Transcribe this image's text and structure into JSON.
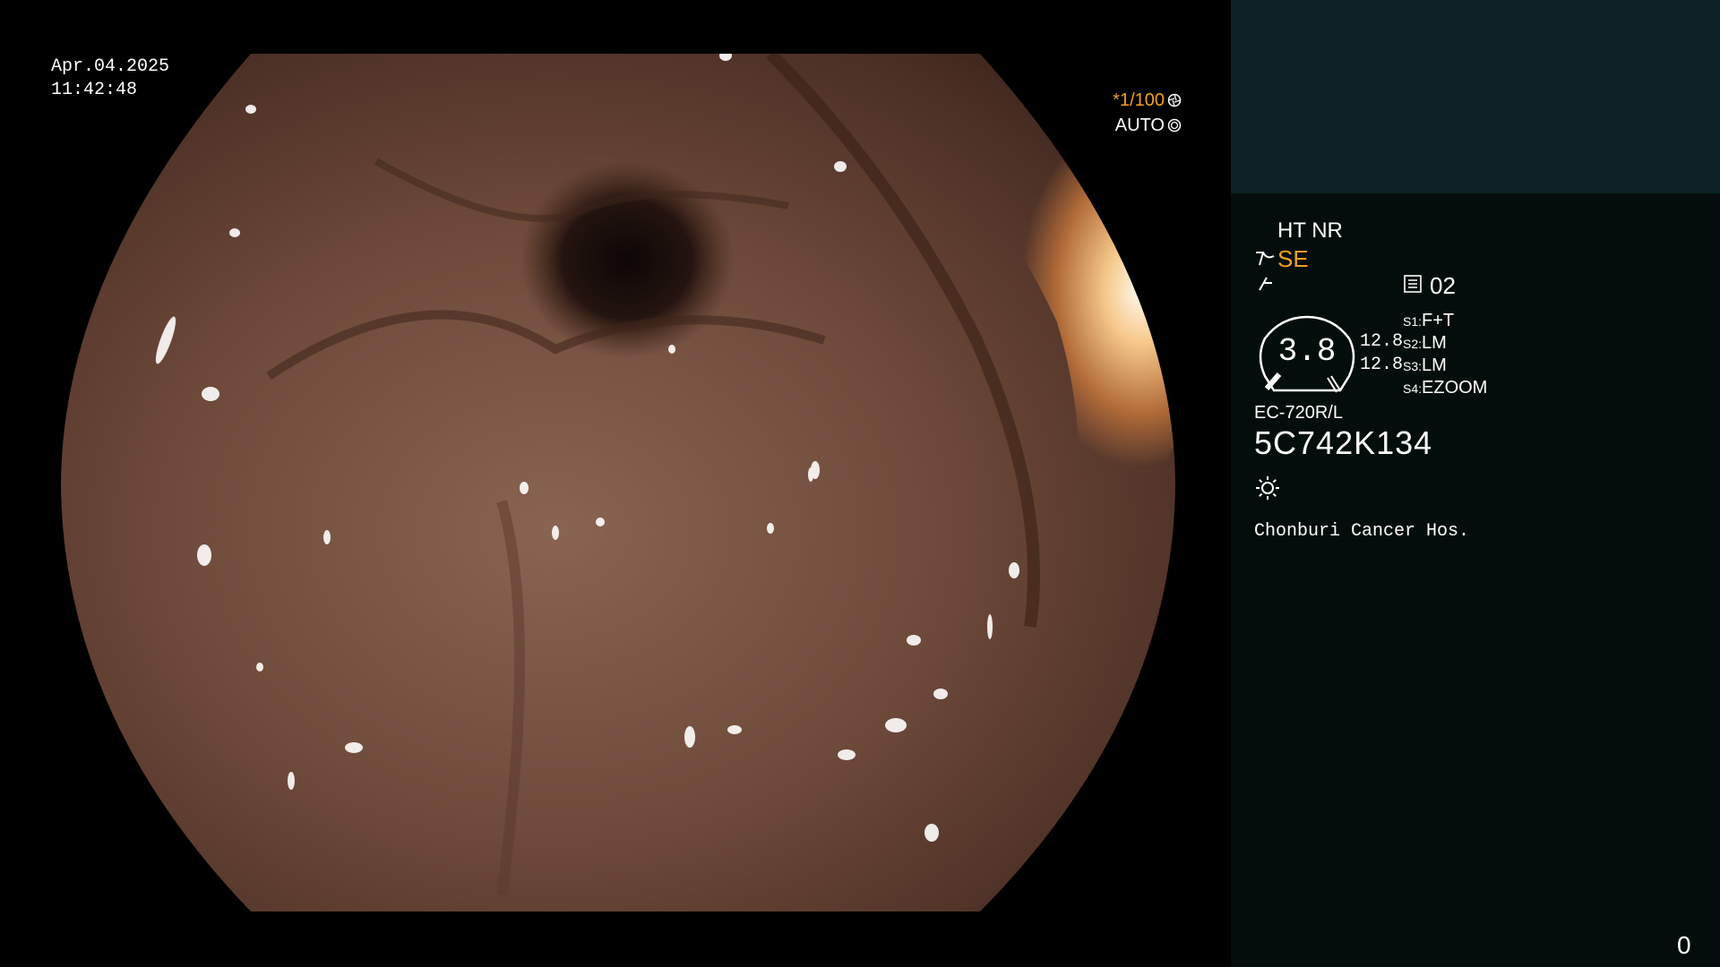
{
  "overlay": {
    "date": "Apr.04.2025",
    "time": "11:42:48",
    "shutter_speed": "*1/100",
    "exposure_mode": "AUTO",
    "icons": {
      "shutter": "shutter-icon",
      "exposure": "iris-icon"
    }
  },
  "info_panel": {
    "enhancement": "HT NR",
    "mode_label": "SE",
    "preset_number": "02",
    "dial_value": "3.8",
    "values": [
      "12.8",
      "12.8"
    ],
    "switches": [
      {
        "key": "S1:",
        "value": "F+T"
      },
      {
        "key": "S2:",
        "value": "LM"
      },
      {
        "key": "S3:",
        "value": "LM"
      },
      {
        "key": "S4:",
        "value": "EZOOM"
      }
    ],
    "scope_model": "EC-720R/L",
    "scope_serial": "5C742K134",
    "hospital": "Chonburi Cancer Hos.",
    "frame_counter": "0",
    "icons": [
      "structure-enhance-icon",
      "contrast-icon",
      "preset-icon",
      "light-icon"
    ]
  },
  "colors": {
    "accent": "#f0a020",
    "panel_top": "#0c2222",
    "panel_bottom": "#030e0c",
    "background": "#000000"
  }
}
